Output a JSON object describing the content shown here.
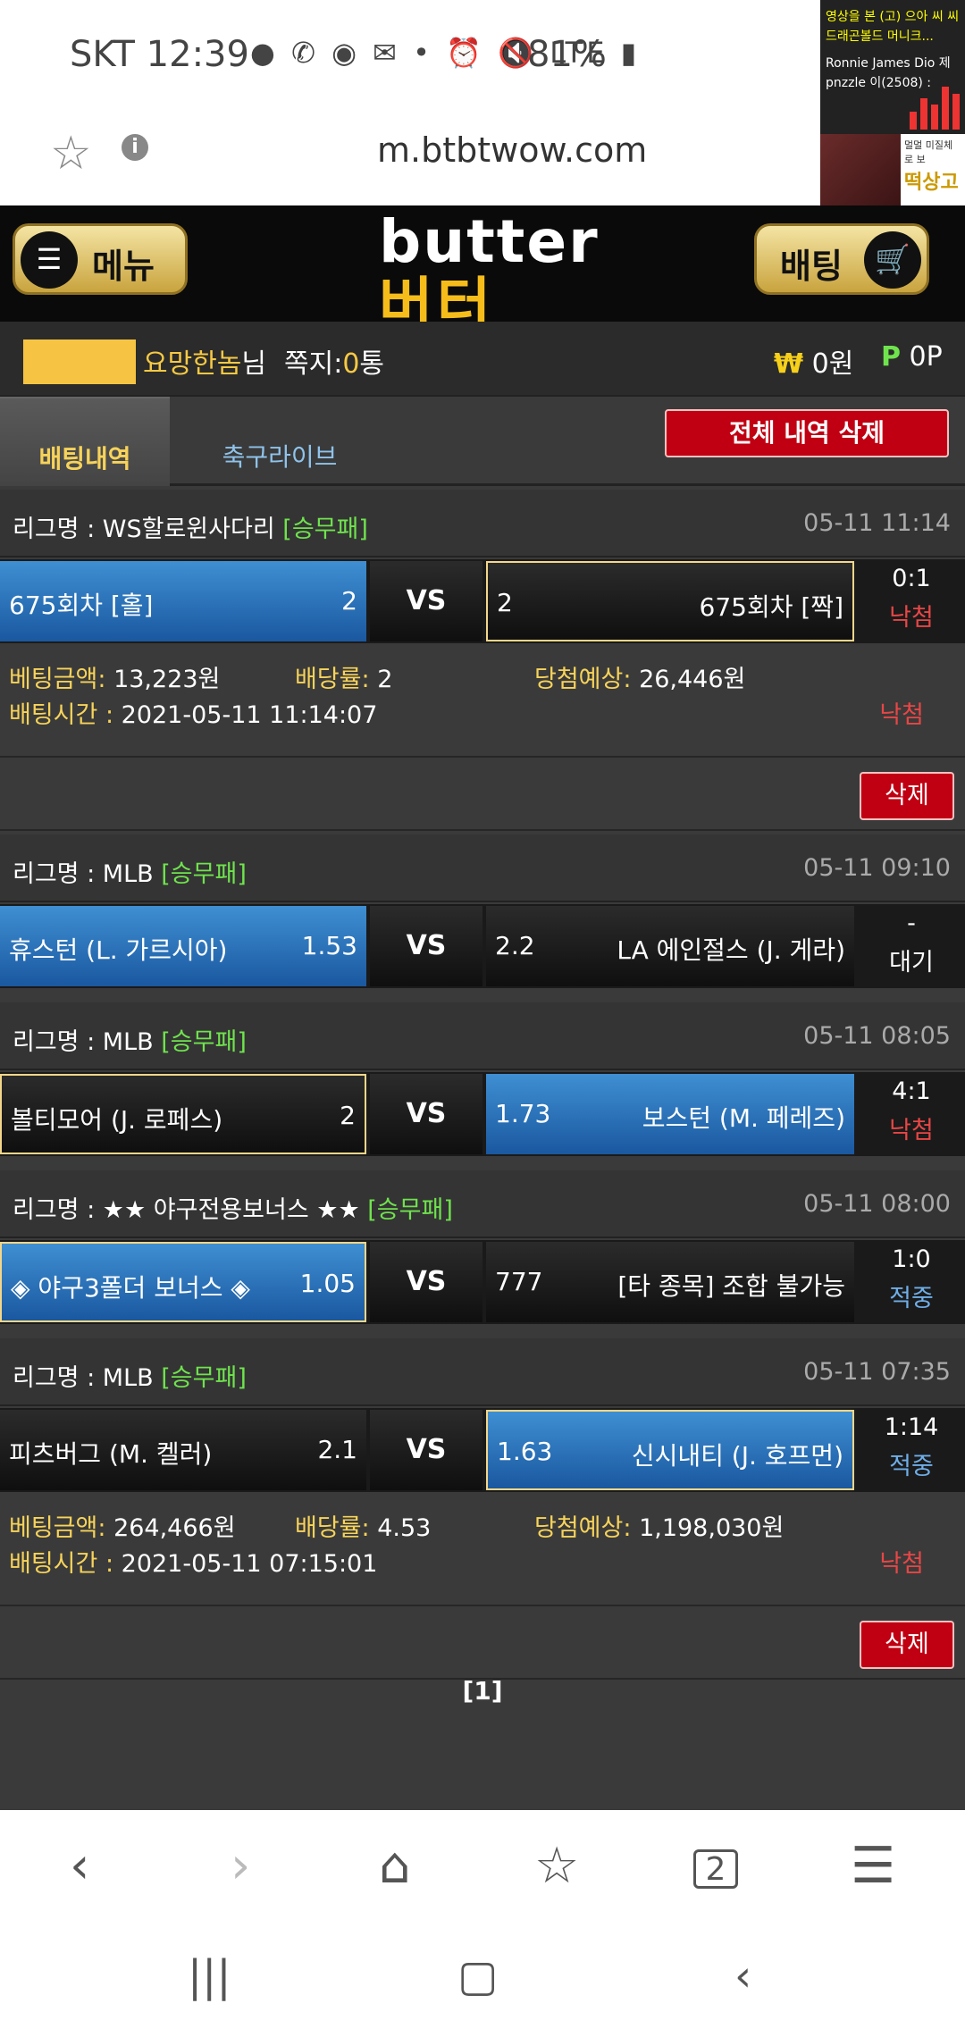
{
  "status": {
    "carrier_time": "SKT 12:39",
    "icons": "● ✆ ◉ ✉ • ⏰ 🔇 LTE ▮ ",
    "battery": "81%"
  },
  "browser": {
    "url": "m.btbtwow.com"
  },
  "thumbnail": {
    "line1": "영상을 본 (고) 으아 씨 씨",
    "line2": "드래곤볼드 머니크...",
    "line3": "Ronnie James Dio 제",
    "line4": "pnzzle 이(2508) :",
    "ad_line1": "멀멀 미질체로 보",
    "ad_line2": "떡상고"
  },
  "header": {
    "menu_label": "메뉴",
    "bet_label": "배팅",
    "logo_en": "butter",
    "logo_ko": "버터"
  },
  "user": {
    "name": "요망한놈",
    "name_suffix": "님",
    "msg_label": "쪽지:",
    "msg_count": "0",
    "msg_unit": "통",
    "cash_symbol": "₩",
    "cash": "0원",
    "point_symbol": "P",
    "point": "0P"
  },
  "tabs": {
    "active": "배팅내역",
    "live": "축구라이브",
    "delete_all": "전체 내역 삭제"
  },
  "league_prefix": "리그명 : ",
  "summary_labels": {
    "amount": "베팅금액:",
    "odds": "배당률:",
    "expected": "당첨예상:",
    "time": "배팅시간 :"
  },
  "cards": [
    {
      "league": "WS할로윈사다리",
      "type": "[승무패]",
      "time": "05-11 11:14",
      "home": "675회차 [홀]",
      "home_odds": "2",
      "vs": "VS",
      "away_odds": "2",
      "away": "675회차 [짝]",
      "score": "0:1",
      "status": "낙첨"
    },
    {
      "league": "MLB",
      "type": "[승무패]",
      "time": "05-11 09:10",
      "home": "휴스턴 (L. 가르시아)",
      "home_odds": "1.53",
      "vs": "VS",
      "away_odds": "2.2",
      "away": "LA 에인절스 (J. 게라)",
      "score": "-",
      "status": "대기"
    },
    {
      "league": "MLB",
      "type": "[승무패]",
      "time": "05-11 08:05",
      "home": "볼티모어 (J. 로페스)",
      "home_odds": "2",
      "vs": "VS",
      "away_odds": "1.73",
      "away": "보스턴 (M. 페레즈)",
      "score": "4:1",
      "status": "낙첨"
    },
    {
      "league": "★★ 야구전용보너스 ★★",
      "type": "[승무패]",
      "time": "05-11 08:00",
      "home": "◈ 야구3폴더 보너스 ◈",
      "home_odds": "1.05",
      "vs": "VS",
      "away_odds": "777",
      "away": "[타 종목] 조합 불가능",
      "score": "1:0",
      "status": "적중"
    },
    {
      "league": "MLB",
      "type": "[승무패]",
      "time": "05-11 07:35",
      "home": "피츠버그 (M. 켈러)",
      "home_odds": "2.1",
      "vs": "VS",
      "away_odds": "1.63",
      "away": "신시내티 (J. 호프먼)",
      "score": "1:14",
      "status": "적중"
    }
  ],
  "slips": [
    {
      "amount": "13,223원",
      "odds": "2",
      "expected": "26,446원",
      "time": "2021-05-11 11:14:07",
      "result": "낙첨",
      "delete": "삭제"
    },
    {
      "amount": "264,466원",
      "odds": "4.53",
      "expected": "1,198,030원",
      "time": "2021-05-11 07:15:01",
      "result": "낙첨",
      "delete": "삭제"
    }
  ],
  "pager": "[1]",
  "nav_icons": [
    "back-icon",
    "forward-icon",
    "home-icon",
    "bookmarks-icon",
    "tabs-icon",
    "menu-icon"
  ],
  "tabs_count": "2",
  "colors": {
    "accent_gold": "#f7c943",
    "type_green": "#6fe34d",
    "lose_red": "#e84646",
    "win_blue": "#6faee8",
    "selected_blue": "#3f8fd2",
    "delete_red": "#c00012"
  }
}
